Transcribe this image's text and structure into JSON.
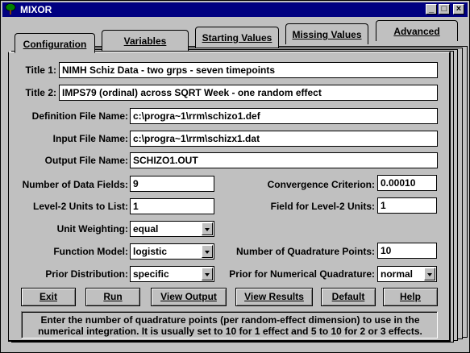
{
  "window": {
    "title": "MIXOR",
    "minimize_glyph": "_",
    "maximize_glyph": "□",
    "close_glyph": "×"
  },
  "tabs": [
    {
      "label": "Configuration",
      "active": true
    },
    {
      "label": "Variables",
      "active": false
    },
    {
      "label": "Starting Values",
      "active": false
    },
    {
      "label": "Missing Values",
      "active": false
    },
    {
      "label": "Advanced",
      "active": false
    }
  ],
  "form": {
    "title1_label": "Title 1:",
    "title1_value": "NIMH Schiz Data - two grps - seven timepoints",
    "title2_label": "Title 2:",
    "title2_value": "IMPS79 (ordinal) across SQRT Week - one random effect",
    "def_file_label": "Definition File Name:",
    "def_file_value": "c:\\progra~1\\rrm\\schizo1.def",
    "input_file_label": "Input File Name:",
    "input_file_value": "c:\\progra~1\\rrm\\schizx1.dat",
    "output_file_label": "Output File Name:",
    "output_file_value": "SCHIZO1.OUT",
    "num_fields_label": "Number of Data Fields:",
    "num_fields_value": "9",
    "convergence_label": "Convergence Criterion:",
    "convergence_value": "0.00010",
    "level2_list_label": "Level-2 Units to List:",
    "level2_list_value": "1",
    "level2_field_label": "Field for Level-2 Units:",
    "level2_field_value": "1",
    "unit_weighting_label": "Unit Weighting:",
    "unit_weighting_value": "equal",
    "function_model_label": "Function Model:",
    "function_model_value": "logistic",
    "quad_points_label": "Number of Quadrature Points:",
    "quad_points_value": "10",
    "prior_dist_label": "Prior Distribution:",
    "prior_dist_value": "specific",
    "prior_quad_label": "Prior for Numerical Quadrature:",
    "prior_quad_value": "normal"
  },
  "buttons": {
    "exit": "Exit",
    "run": "Run",
    "view_output": "View Output",
    "view_results": "View Results",
    "default": "Default",
    "help": "Help"
  },
  "help_text": "Enter the number of quadrature points (per random-effect dimension) to use in the numerical integration.  It is usually set to 10 for 1 effect and 5 to 10 for 2 or 3 effects.",
  "colors": {
    "titlebar": "#000080",
    "face": "#c0c0c0"
  }
}
